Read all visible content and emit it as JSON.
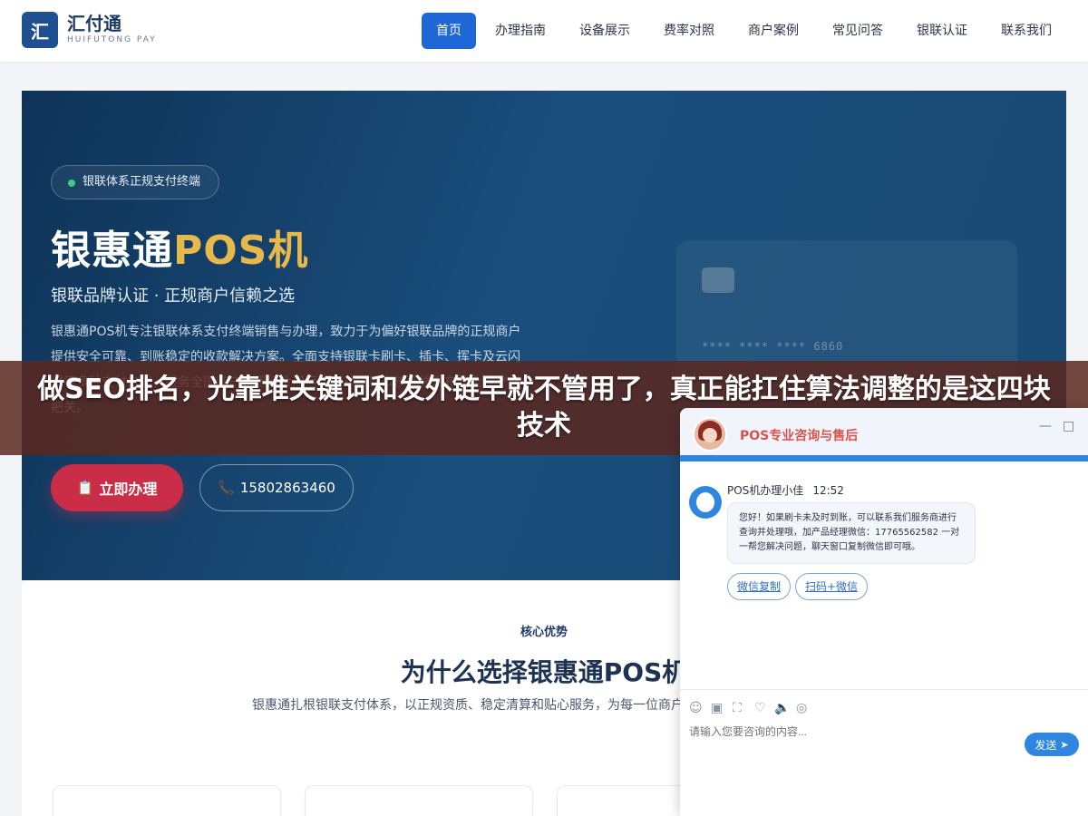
{
  "logo": {
    "mark": "汇",
    "name": "汇付通",
    "subtitle": "HUIFUTONG PAY"
  },
  "nav": {
    "items": [
      "首页",
      "办理指南",
      "设备展示",
      "费率对照",
      "商户案例",
      "常见问答",
      "银联认证",
      "联系我们"
    ],
    "active_index": 0
  },
  "hero": {
    "badge": "银联体系正规支付终端",
    "title_main": "银惠通",
    "title_accent": "POS机",
    "subtitle": "银联品牌认证 · 正规商户信赖之选",
    "description": "银惠通POS机专注银联体系支付终端销售与办理，致力于为偏好银联品牌的正规商户提供安全可靠、到账稳定的收款解决方案。全面支持银联卡刷卡、插卡、挥卡及云闪付等多种支付方式，服务全国商户，坚持合规运营，从资质审核到终端布放全程严格把关。",
    "card_number": "**** **** **** 6860",
    "apply_button": "立即办理",
    "phone_button": "15802863460"
  },
  "overlay": {
    "title": "做SEO排名，光靠堆关键词和发外链早就不管用了，真正能扛住算法调整的是这四块技术"
  },
  "section": {
    "tag": "核心优势",
    "title": "为什么选择银惠通POS机",
    "description": "银惠通扎根银联支付体系，以正规资质、稳定清算和贴心服务，为每一位商户提供值得信赖的收款终端。"
  },
  "chat": {
    "header_title": "POS专业咨询与售后",
    "minimize": "—",
    "maximize": "□",
    "agent_name": "POS机办理小佳",
    "agent_time": "12:52",
    "message": "您好！如果刷卡未及时到账，可以联系我们服务商进行查询并处理哦，加产品经理微信：17765562582 一对一帮您解决问题，聊天窗口复制微信即可哦。",
    "quick_replies": [
      "微信复制",
      "扫码+微信"
    ],
    "input_placeholder": "请输入您要咨询的内容...",
    "send_label": "发送",
    "colors": {
      "accent": "#2f86e0",
      "header_text": "#d9534f"
    }
  }
}
